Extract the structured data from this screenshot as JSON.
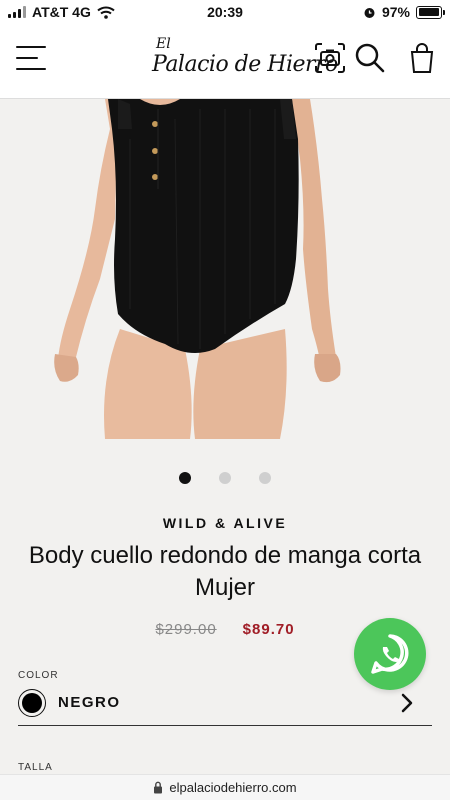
{
  "status_bar": {
    "carrier": "AT&T 4G",
    "time": "20:39",
    "battery": "97%",
    "battery_level": 0.97
  },
  "header": {
    "logo_prefix": "El",
    "logo_name": "Palacio de Hierro",
    "icons": [
      "menu-icon",
      "camera-search-icon",
      "search-icon",
      "shopping-bag-icon"
    ]
  },
  "carousel": {
    "total": 3,
    "active_index": 0
  },
  "product": {
    "brand": "WILD & ALIVE",
    "title": "Body cuello redondo de manga corta Mujer",
    "old_price": "$299.00",
    "price": "$89.70"
  },
  "color": {
    "label": "COLOR",
    "selected": "NEGRO",
    "swatch": "#000000"
  },
  "size": {
    "label": "TALLA"
  },
  "browser": {
    "url": "elpalaciodehierro.com"
  },
  "colors": {
    "accent_price": "#a01d26",
    "whatsapp": "#4cc65a"
  }
}
